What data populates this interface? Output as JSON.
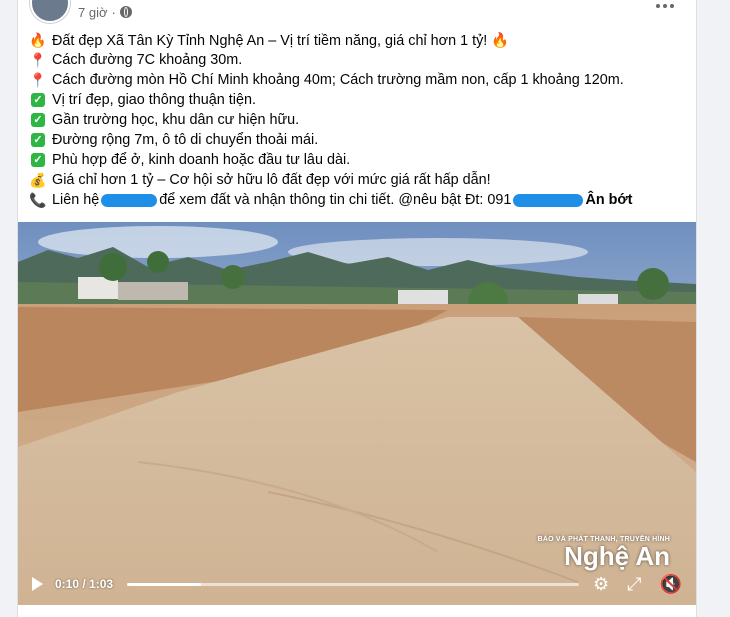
{
  "post": {
    "time": "7 giờ",
    "lines": [
      {
        "icon": "fire-icon",
        "glyph": "🔥",
        "text": "Đất đẹp  Xã Tân Kỳ Tỉnh Nghệ An – Vị trí tiềm năng, giá chỉ hơn 1 tỷ! 🔥"
      },
      {
        "icon": "pin-icon",
        "glyph": "📍",
        "text": "Cách đường 7C khoảng 30m."
      },
      {
        "icon": "pin-icon",
        "glyph": "📍",
        "text": "Cách đường mòn Hồ Chí Minh khoảng 40m; Cách trường mầm non, cấp 1 khoảng 120m."
      },
      {
        "icon": "check-icon",
        "glyph": "✓",
        "text": "Vị trí đẹp, giao thông thuận tiện."
      },
      {
        "icon": "check-icon",
        "glyph": "✓",
        "text": "Gần trường học, khu dân cư hiện hữu."
      },
      {
        "icon": "check-icon",
        "glyph": "✓",
        "text": "Đường rộng 7m, ô tô di chuyển thoải mái."
      },
      {
        "icon": "check-icon",
        "glyph": "✓",
        "text": "Phù hợp để ở, kinh doanh hoặc đầu tư lâu dài."
      },
      {
        "icon": "money-bag-icon",
        "glyph": "💰",
        "text": "Giá chỉ hơn 1 tỷ – Cơ hội sở hữu lô đất đẹp với mức giá rất hấp dẫn!"
      }
    ],
    "contact": {
      "prefix": "Liên hệ",
      "middle": "để xem đất và nhận thông tin chi tiết. @nêu bật Đt: 091",
      "suffix": "Ân bớt"
    }
  },
  "video": {
    "current_time": "0:10",
    "duration": "1:03",
    "progress_fraction": 0.164,
    "watermark_small": "BÁO VÀ PHÁT THANH, TRUYỀN HÌNH",
    "watermark_big": "Nghệ An"
  },
  "colors": {
    "redaction": "#1f8ee6",
    "check": "#2db742"
  }
}
